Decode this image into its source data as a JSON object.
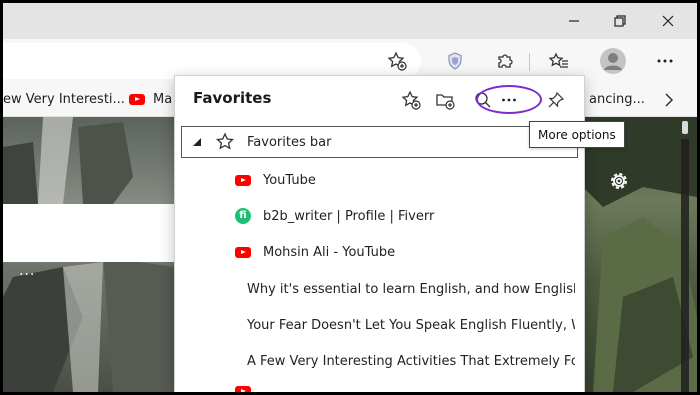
{
  "titlebar": {
    "minimize_icon": "minimize-icon",
    "restore_icon": "restore-icon",
    "close_icon": "close-icon"
  },
  "toolbar": {
    "add_favorite_icon": "star-add-icon",
    "extension_icon": "shield-extension-icon",
    "extensions_icon": "puzzle-icon",
    "favorites_icon": "favorites-icon",
    "profile_icon": "profile-avatar",
    "menu_icon": "ellipsis-icon"
  },
  "bookmarks_bar": {
    "items": [
      {
        "label": "ew Very Interesti...",
        "icon": "none"
      },
      {
        "label": "Ma",
        "icon": "youtube-icon"
      },
      {
        "label": "ancing...",
        "icon": "none"
      }
    ],
    "chevron": "chevron-right-icon"
  },
  "favorites_panel": {
    "title": "Favorites",
    "tooltip": "More options",
    "favorites_bar_label": "Favorites bar",
    "items": [
      {
        "label": "YouTube",
        "icon": "youtube"
      },
      {
        "label": "b2b_writer | Profile | Fiverr",
        "icon": "fiverr"
      },
      {
        "label": "Mohsin Ali - YouTube",
        "icon": "youtube"
      },
      {
        "label": "Why it's essential to learn English, and how English",
        "icon": "youtube"
      },
      {
        "label": "Your Fear Doesn't Let You Speak English Fluently, W",
        "icon": "youtube"
      },
      {
        "label": "A Few Very Interesting Activities That Extremely For",
        "icon": "youtube"
      }
    ]
  },
  "page": {
    "card_dots": "···"
  },
  "colors": {
    "highlight": "#7b2ccf",
    "youtube": "#ff0000",
    "fiverr": "#1dbf73"
  }
}
